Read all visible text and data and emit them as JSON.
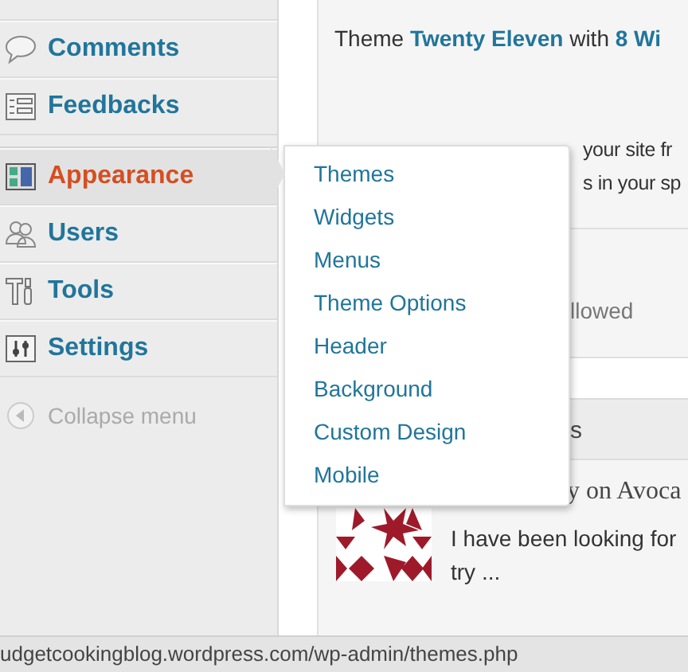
{
  "sidebar": {
    "items": [
      {
        "kind": "menu",
        "label": "Comments",
        "selected": false
      },
      {
        "kind": "menu",
        "label": "Feedbacks",
        "selected": false
      },
      {
        "kind": "separator"
      },
      {
        "kind": "menu",
        "label": "Appearance",
        "selected": true
      },
      {
        "kind": "menu",
        "label": "Users",
        "selected": false
      },
      {
        "kind": "menu",
        "label": "Tools",
        "selected": false
      },
      {
        "kind": "menu",
        "label": "Settings",
        "selected": false
      },
      {
        "kind": "collapse",
        "label": "Collapse menu"
      }
    ]
  },
  "flyout": {
    "items": [
      "Themes",
      "Widgets",
      "Menus",
      "Theme Options",
      "Header",
      "Background",
      "Custom Design",
      "Mobile"
    ]
  },
  "main": {
    "theme_line": "Theme **Twenty Eleven** with **8 Wi**",
    "partial_lines": [
      "your site fr",
      "s in your sp"
    ],
    "allowed_text": "llowed",
    "box_heading": "s",
    "comment": {
      "title": "y on Avoca",
      "excerpt": "I have been looking for",
      "excerpt_more": "try ..."
    }
  },
  "status_bar": {
    "url": "udgetcookingblog.wordpress.com/wp-admin/themes.php"
  }
}
